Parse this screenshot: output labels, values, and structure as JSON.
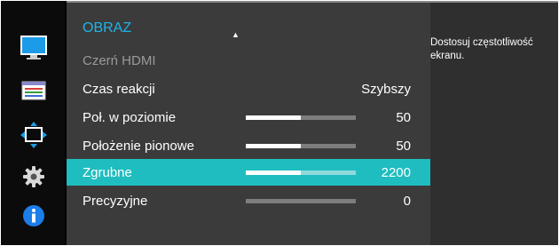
{
  "sidebar": {
    "icons": [
      {
        "name": "picture-icon",
        "selected": true
      },
      {
        "name": "onscreen-display-icon",
        "selected": false
      },
      {
        "name": "position-size-icon",
        "selected": false
      },
      {
        "name": "settings-gear-icon",
        "selected": false
      },
      {
        "name": "information-icon",
        "selected": false
      }
    ]
  },
  "menu": {
    "title": "OBRAZ",
    "items": [
      {
        "label": "Czerń HDMI",
        "value": "",
        "disabled": true
      },
      {
        "label": "Czas reakcji",
        "value": "Szybszy"
      },
      {
        "label": "Poł. w poziomie",
        "value": "50",
        "slider_fraction": 0.5
      },
      {
        "label": "Położenie pionowe",
        "value": "50",
        "slider_fraction": 0.5
      },
      {
        "label": "Zgrubne",
        "value": "2200",
        "slider_fraction": 0.5,
        "selected": true
      },
      {
        "label": "Precyzyjne",
        "value": "0",
        "slider_fraction": 0.0
      }
    ]
  },
  "info": {
    "text": "Dostosuj częstotliwość\nekranu."
  },
  "colors": {
    "accent": "#1bb5ea",
    "selected_row": "#1fbdbf",
    "panel": "#3b3b3b"
  }
}
